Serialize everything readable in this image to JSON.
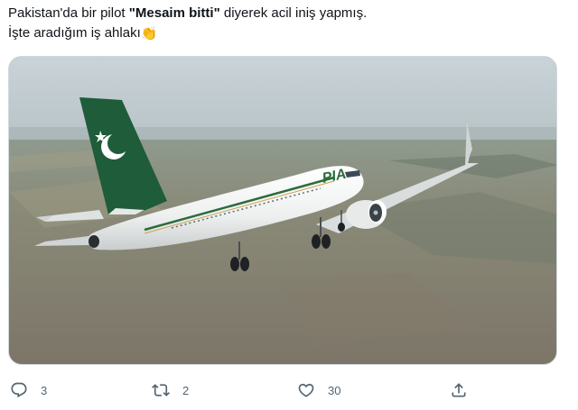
{
  "tweet": {
    "line1_prefix": "Pakistan'da bir pilot ",
    "line1_bold": "\"Mesaim bitti\"",
    "line1_suffix": " diyerek acil iniş yapmış.",
    "line2": "İşte aradığım iş ahlakı",
    "emoji": "👏"
  },
  "media": {
    "description_icon": "airplane-photo",
    "airline_logo_text": "PIA"
  },
  "actions": {
    "reply_count": "3",
    "retweet_count": "2",
    "like_count": "30"
  },
  "icons": {
    "reply": "reply-icon",
    "retweet": "retweet-icon",
    "like": "heart-icon",
    "share": "share-icon"
  },
  "colors": {
    "text": "#0f1419",
    "secondary": "#536471",
    "tail_green": "#1f5c3a"
  }
}
